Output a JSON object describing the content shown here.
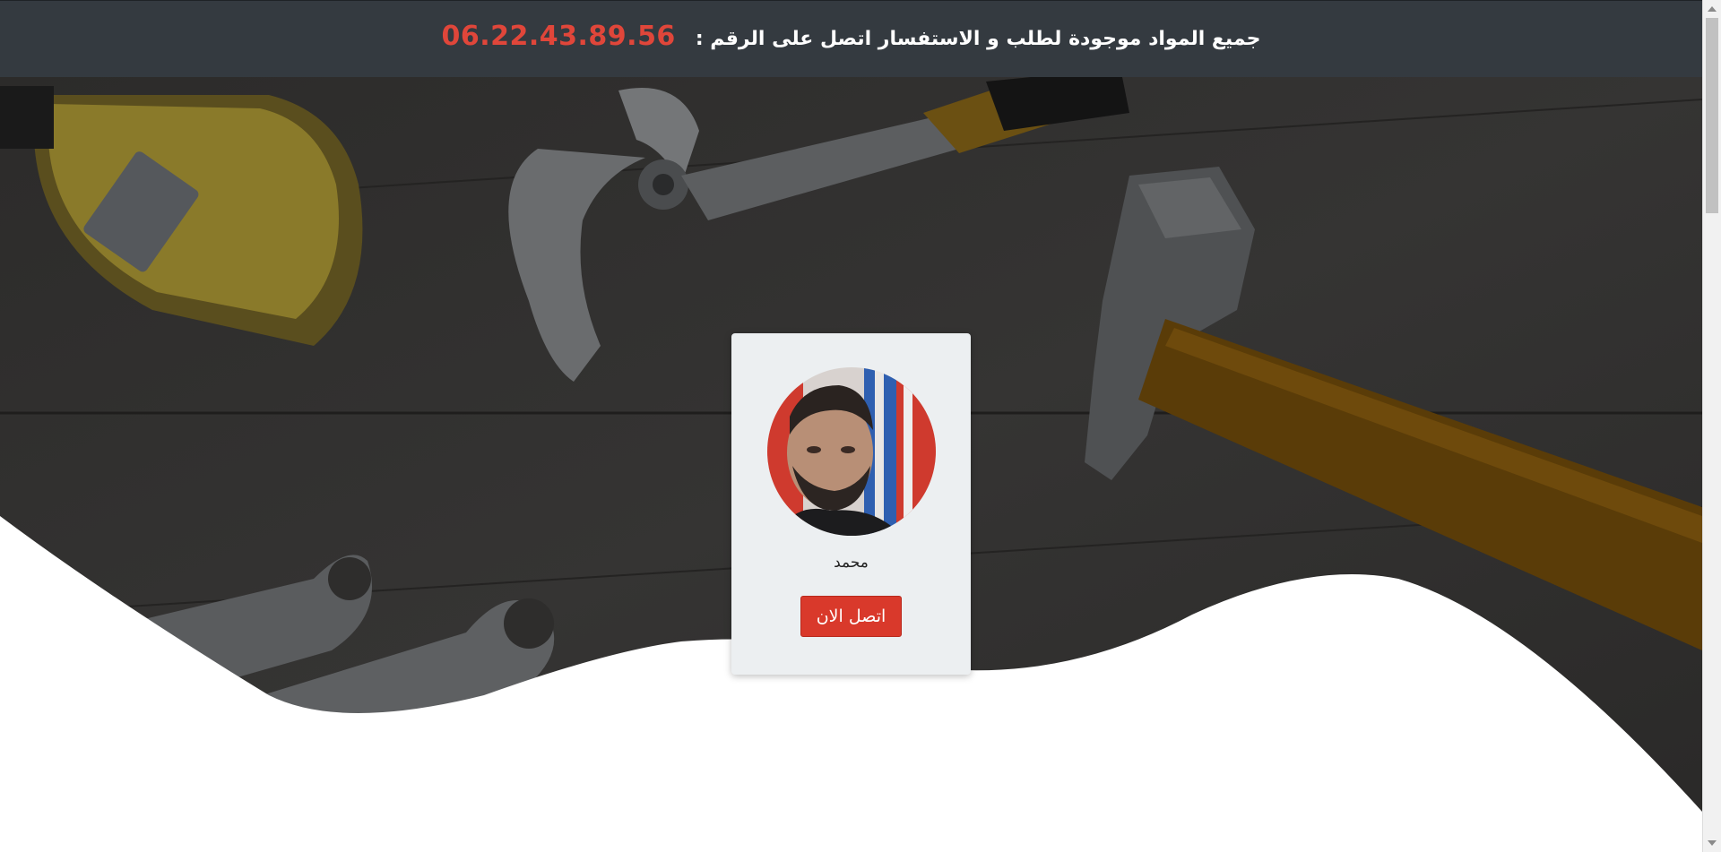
{
  "header": {
    "message": "جميع المواد موجودة لطلب و الاستفسار اتصل على الرقم :",
    "phone": "06.22.43.89.56"
  },
  "profile": {
    "name": "محمد",
    "call_button_label": "اتصل الان"
  },
  "colors": {
    "header_bg": "#343a40",
    "phone_accent": "#e0463a",
    "button_bg": "#d9392b",
    "card_bg": "#eceff1"
  },
  "icons": {
    "hero_background": "tools-background-image",
    "avatar": "profile-photo"
  }
}
